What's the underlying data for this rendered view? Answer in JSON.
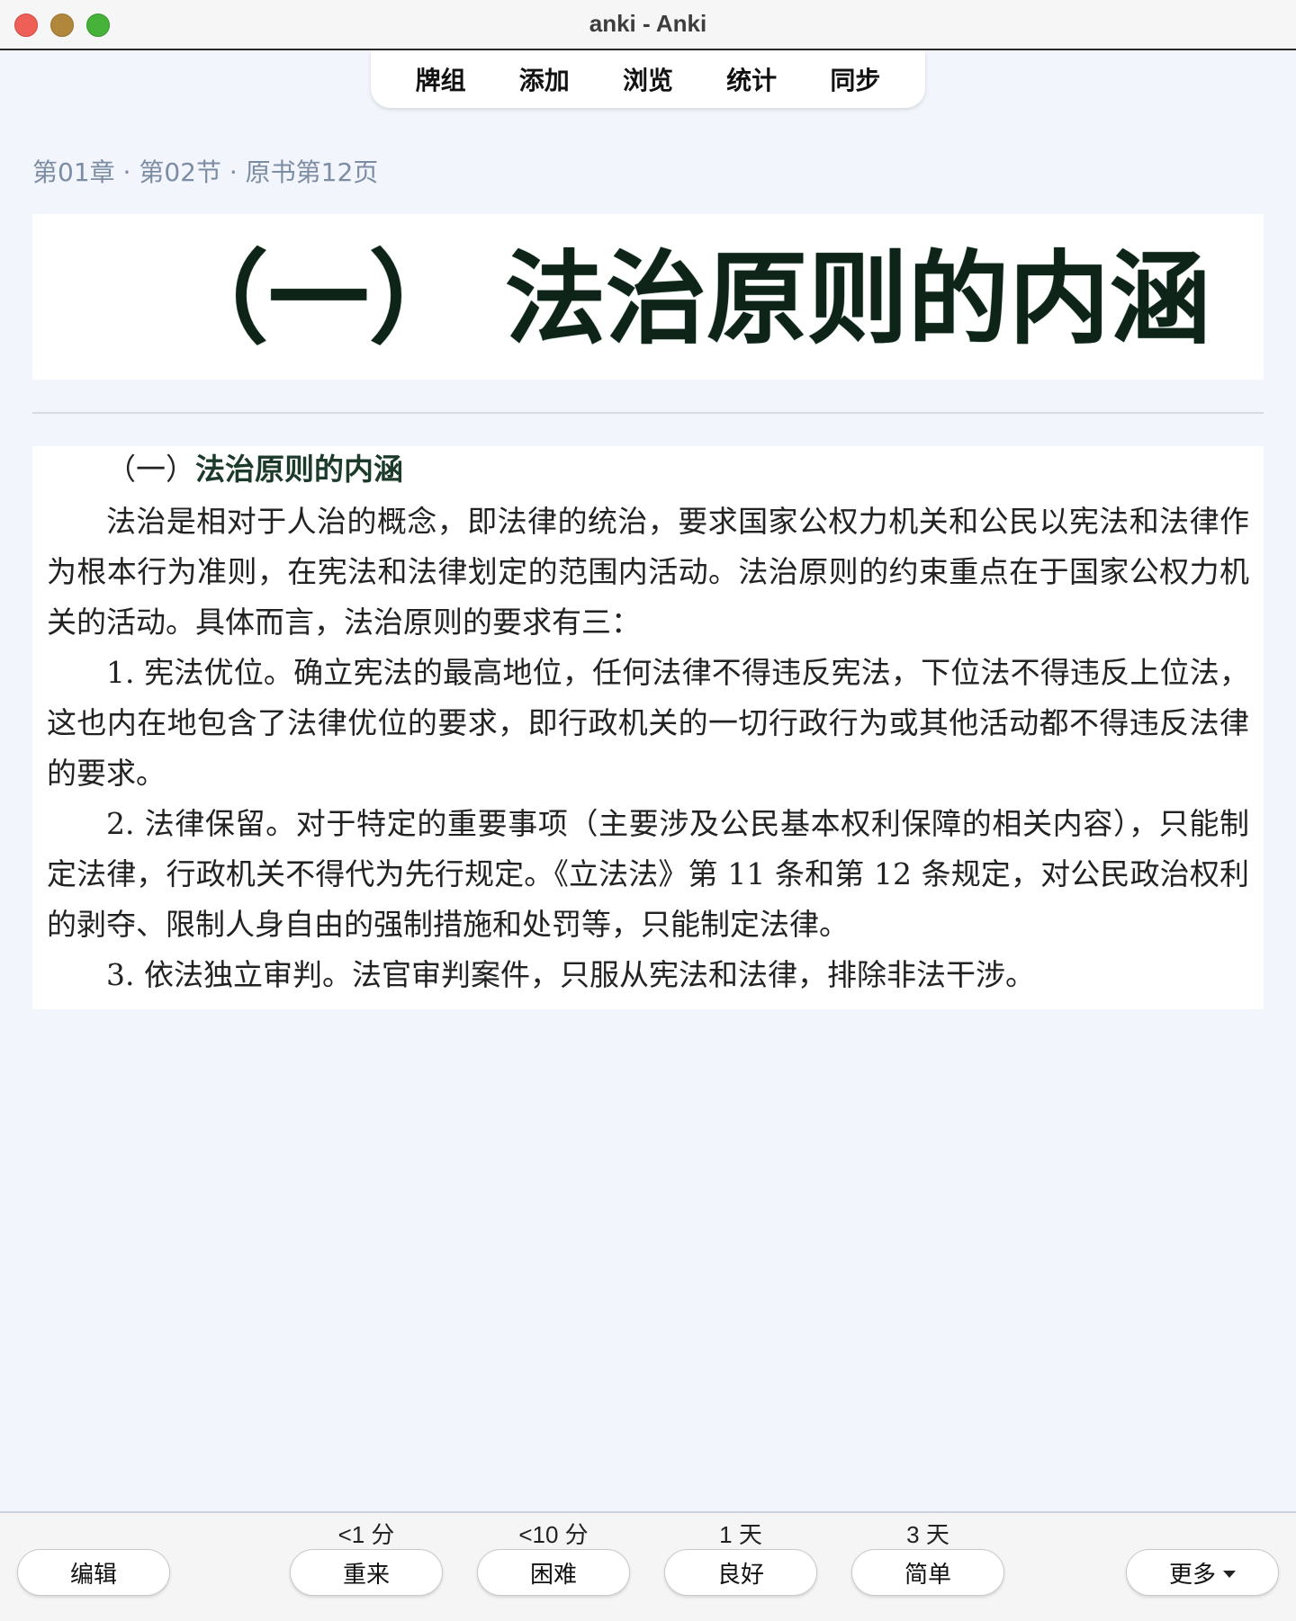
{
  "window": {
    "title": "anki - Anki"
  },
  "nav": {
    "items": [
      "牌组",
      "添加",
      "浏览",
      "统计",
      "同步"
    ]
  },
  "card": {
    "breadcrumb": "第01章 · 第02节 · 原书第12页",
    "heading_image_text": "（一） 法治原则的内涵",
    "section_number": "（一）",
    "section_title": "法治原则的内涵",
    "paragraphs": [
      "法治是相对于人治的概念，即法律的统治，要求国家公权力机关和公民以宪法和法律作为根本行为准则，在宪法和法律划定的范围内活动。法治原则的约束重点在于国家公权力机关的活动。具体而言，法治原则的要求有三：",
      "1. 宪法优位。确立宪法的最高地位，任何法律不得违反宪法，下位法不得违反上位法，这也内在地包含了法律优位的要求，即行政机关的一切行政行为或其他活动都不得违反法律的要求。",
      "2. 法律保留。对于特定的重要事项（主要涉及公民基本权利保障的相关内容），只能制定法律，行政机关不得代为先行规定。《立法法》第 11 条和第 12 条规定，对公民政治权利的剥夺、限制人身自由的强制措施和处罚等，只能制定法律。",
      "3. 依法独立审判。法官审判案件，只服从宪法和法律，排除非法干涉。"
    ]
  },
  "bottom": {
    "edit_label": "编辑",
    "more_label": "更多",
    "answers": [
      {
        "interval": "<1 分",
        "label": "重来"
      },
      {
        "interval": "<10 分",
        "label": "困难"
      },
      {
        "interval": "1 天",
        "label": "良好"
      },
      {
        "interval": "3 天",
        "label": "简单"
      }
    ]
  }
}
